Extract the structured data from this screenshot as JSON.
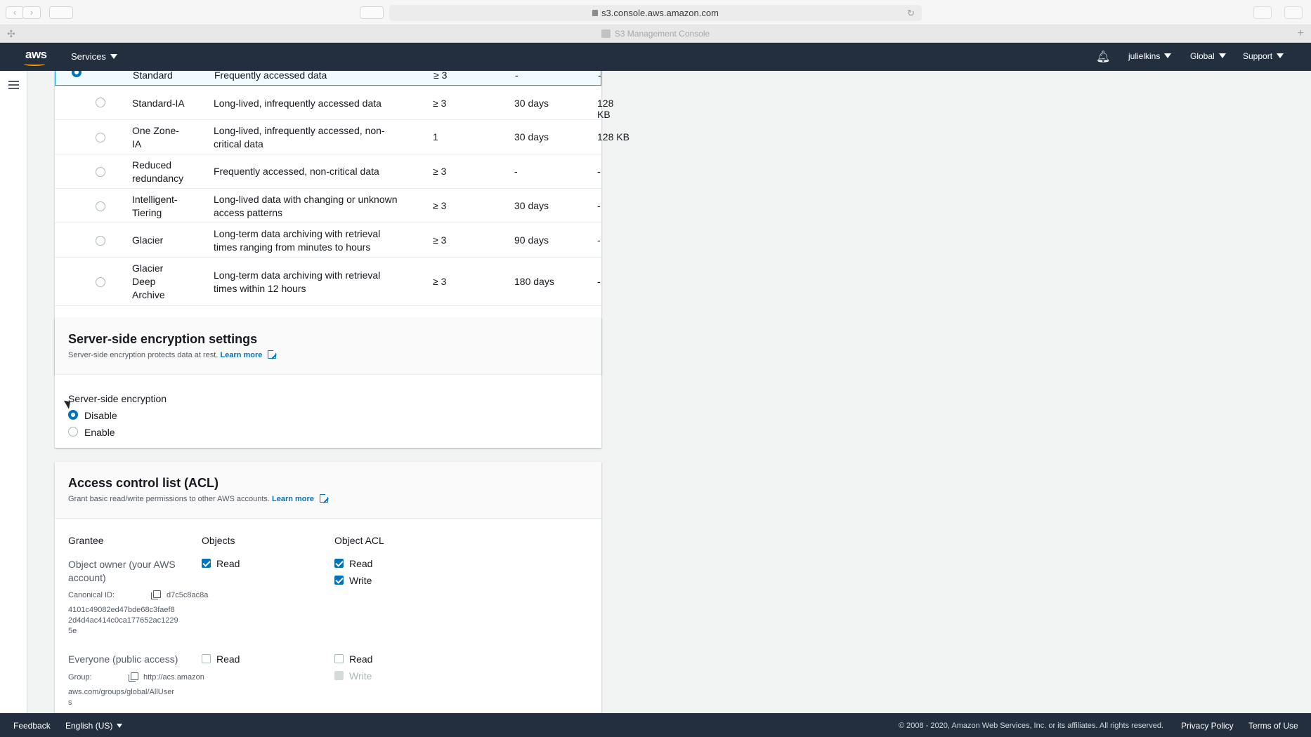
{
  "browser": {
    "url": "s3.console.aws.amazon.com",
    "tab_title": "S3 Management Console"
  },
  "header": {
    "logo": "aws",
    "services_label": "Services",
    "user_label": "julielkins",
    "region_label": "Global",
    "support_label": "Support"
  },
  "storage_classes": {
    "rows": [
      {
        "name": "Standard",
        "description": "Frequently accessed data",
        "az": "≥ 3",
        "min_duration": "-",
        "min_size": "-",
        "selected": true
      },
      {
        "name": "Standard-IA",
        "description": "Long-lived, infrequently accessed data",
        "az": "≥ 3",
        "min_duration": "30 days",
        "min_size": "128 KB",
        "selected": false
      },
      {
        "name": "One Zone-\nIA",
        "description": "Long-lived, infrequently accessed, non-\ncritical data",
        "az": "1",
        "min_duration": "30 days",
        "min_size": "128 KB",
        "selected": false
      },
      {
        "name": "Reduced\nredundancy",
        "description": "Frequently accessed, non-critical data",
        "az": "≥ 3",
        "min_duration": "-",
        "min_size": "-",
        "selected": false
      },
      {
        "name": "Intelligent-\nTiering",
        "description": "Long-lived data with changing or unknown\naccess patterns",
        "az": "≥ 3",
        "min_duration": "30 days",
        "min_size": "-",
        "selected": false
      },
      {
        "name": "Glacier",
        "description": "Long-term data archiving with retrieval\ntimes ranging from minutes to hours",
        "az": "≥ 3",
        "min_duration": "90 days",
        "min_size": "-",
        "selected": false
      },
      {
        "name": "Glacier\nDeep\nArchive",
        "description": "Long-term data archiving with retrieval\ntimes within 12 hours",
        "az": "≥ 3",
        "min_duration": "180 days",
        "min_size": "-",
        "selected": false
      }
    ]
  },
  "encryption": {
    "title": "Server-side encryption settings",
    "subtitle": "Server-side encryption protects data at rest.",
    "learn_more": "Learn more",
    "field_label": "Server-side encryption",
    "options": [
      {
        "label": "Disable",
        "selected": true
      },
      {
        "label": "Enable",
        "selected": false
      }
    ]
  },
  "acl": {
    "title": "Access control list (ACL)",
    "subtitle": "Grant basic read/write permissions to other AWS accounts.",
    "learn_more": "Learn more",
    "columns": {
      "grantee": "Grantee",
      "objects": "Objects",
      "object_acl": "Object ACL"
    },
    "owner": {
      "name": "Object owner (your AWS\naccount)",
      "id_label": "Canonical ID:",
      "id_value_first": "d7c5c8ac8a",
      "id_value_rest": "4101c49082ed47bde68c3faef8\n2d4d4ac414c0ca177652ac1229\n5e",
      "objects_read": "Read",
      "acl_read": "Read",
      "acl_write": "Write"
    },
    "everyone": {
      "name": "Everyone (public access)",
      "group_label": "Group:",
      "group_value_first": "http://acs.amazon",
      "group_value_rest": "aws.com/groups/global/AllUser\ns",
      "objects_read": "Read",
      "acl_read": "Read",
      "acl_write": "Write"
    }
  },
  "footer": {
    "feedback": "Feedback",
    "language": "English (US)",
    "copyright": "© 2008 - 2020, Amazon Web Services, Inc. or its affiliates. All rights reserved.",
    "privacy": "Privacy Policy",
    "terms": "Terms of Use"
  }
}
